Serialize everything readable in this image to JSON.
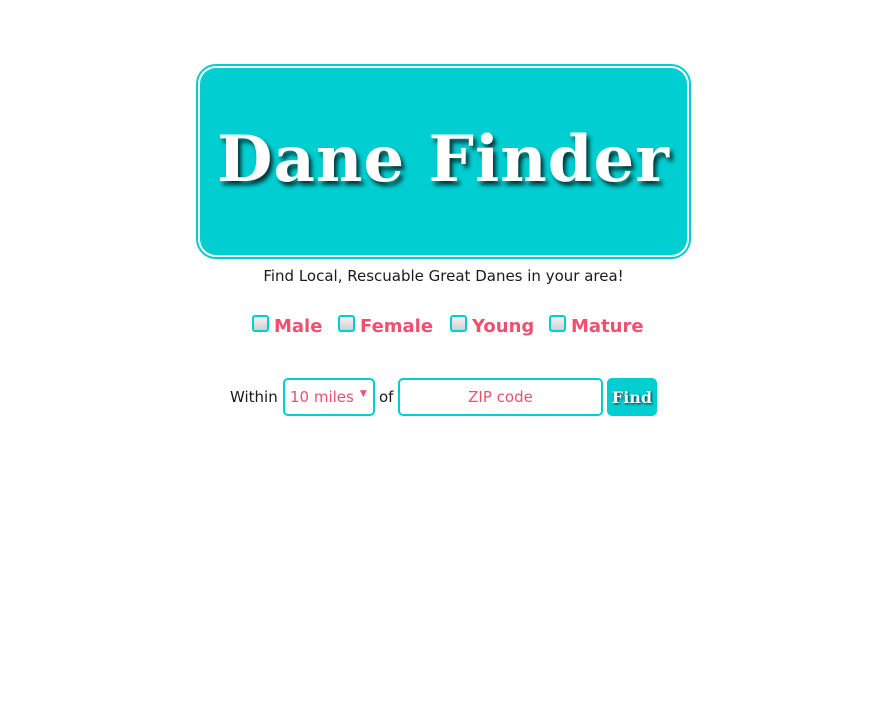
{
  "header": {
    "title": "Dane Finder",
    "tagline": "Find Local, Rescuable Great Danes in your area!"
  },
  "filters": [
    {
      "label": "Male",
      "checked": false
    },
    {
      "label": "Female",
      "checked": false
    },
    {
      "label": "Young",
      "checked": false
    },
    {
      "label": "Mature",
      "checked": false
    }
  ],
  "search": {
    "within_label": "Within",
    "radius_selected": "10 miles",
    "of_label": "of",
    "zip_placeholder": "ZIP code",
    "zip_value": "",
    "find_label": "Find"
  },
  "colors": {
    "accent": "#00ced1",
    "highlight": "#f0506e",
    "text": "#1a1a1a"
  },
  "icons": {
    "select_arrow": "dropdown-arrow-icon"
  }
}
